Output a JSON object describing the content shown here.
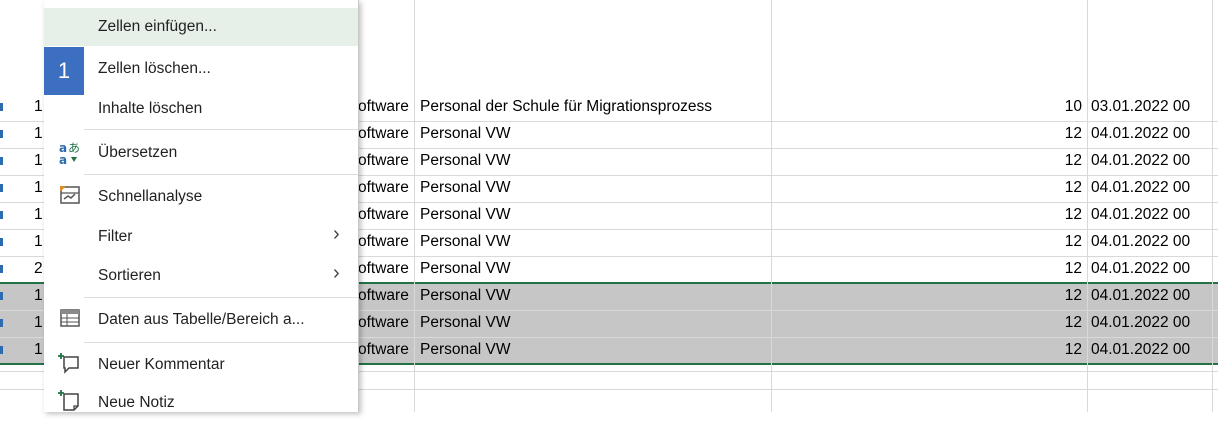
{
  "menu": {
    "step_badge": "1",
    "items": [
      {
        "id": "insert",
        "label": "Zellen einfügen..."
      },
      {
        "id": "delete",
        "label": "Zellen löschen..."
      },
      {
        "id": "clear",
        "label": "Inhalte löschen"
      },
      {
        "id": "translate",
        "label": "Übersetzen",
        "icon": "translate-icon"
      },
      {
        "id": "quick",
        "label": "Schnellanalyse",
        "icon": "quick-analysis-icon"
      },
      {
        "id": "filter",
        "label": "Filter",
        "submenu": true
      },
      {
        "id": "sort",
        "label": "Sortieren",
        "submenu": true
      },
      {
        "id": "table",
        "label": "Daten aus Tabelle/Bereich a...",
        "icon": "table-range-icon"
      },
      {
        "id": "comment",
        "label": "Neuer Kommentar",
        "icon": "new-comment-icon"
      },
      {
        "id": "note",
        "label": "Neue Notiz",
        "icon": "new-note-icon"
      }
    ],
    "chevron": "›"
  },
  "sheet": {
    "rows": [
      {
        "a": "1",
        "c": "oftware",
        "d": "Personal der Schule für Migrationsprozess",
        "e": "10",
        "f": "03.01.2022 00",
        "selected": false
      },
      {
        "a": "1",
        "c": "oftware",
        "d": "Personal VW",
        "e": "12",
        "f": "04.01.2022 00",
        "selected": false
      },
      {
        "a": "1",
        "c": "oftware",
        "d": "Personal VW",
        "e": "12",
        "f": "04.01.2022 00",
        "selected": false
      },
      {
        "a": "1",
        "c": "oftware",
        "d": "Personal VW",
        "e": "12",
        "f": "04.01.2022 00",
        "selected": false
      },
      {
        "a": "1",
        "c": "oftware",
        "d": "Personal VW",
        "e": "12",
        "f": "04.01.2022 00",
        "selected": false
      },
      {
        "a": "1",
        "c": "oftware",
        "d": "Personal VW",
        "e": "12",
        "f": "04.01.2022 00",
        "selected": false
      },
      {
        "a": "2",
        "c": "oftware",
        "d": "Personal VW",
        "e": "12",
        "f": "04.01.2022 00",
        "selected": false
      },
      {
        "a": "1",
        "c": "oftware",
        "d": "Personal VW",
        "e": "12",
        "f": "04.01.2022 00",
        "selected": true
      },
      {
        "a": "1",
        "c": "oftware",
        "d": "Personal VW",
        "e": "12",
        "f": "04.01.2022 00",
        "selected": true
      },
      {
        "a": "1",
        "c": "oftware",
        "d": "Personal VW",
        "e": "12",
        "f": "04.01.2022 00",
        "selected": true
      }
    ]
  },
  "colors": {
    "selection_border": "#217346",
    "hover": "#e6f0e9",
    "badge": "#3c6fbf"
  }
}
